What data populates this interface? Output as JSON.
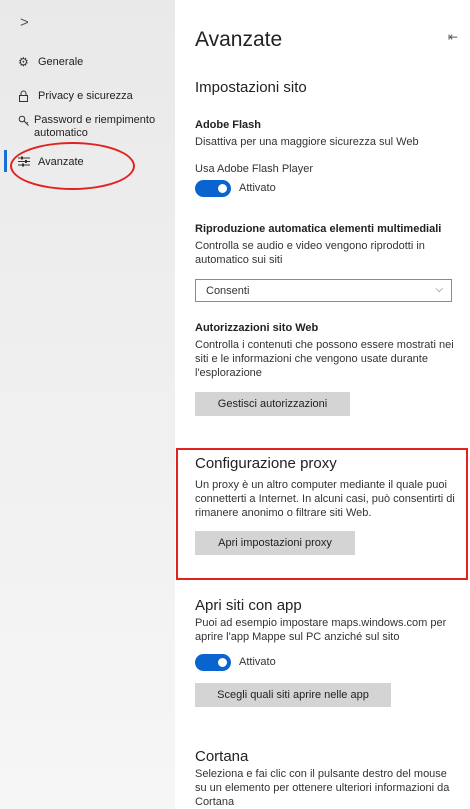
{
  "sidebar": {
    "collapse_glyph": ">",
    "items": [
      {
        "label": "Generale",
        "icon": "gear-icon"
      },
      {
        "label": "Privacy e sicurezza",
        "icon": "lock-icon"
      },
      {
        "label": "Password e riempimento automatico",
        "icon": "key-icon"
      },
      {
        "label": "Avanzate",
        "icon": "sliders-icon"
      }
    ]
  },
  "main": {
    "title": "Avanzate",
    "pin_glyph": "⇤",
    "site_settings": {
      "heading": "Impostazioni sito",
      "flash": {
        "heading": "Adobe Flash",
        "description": "Disattiva per una maggiore sicurezza sul Web",
        "toggle_label": "Usa Adobe Flash Player",
        "toggle_state": "Attivato"
      },
      "autoplay": {
        "heading": "Riproduzione automatica elementi multimediali",
        "description": "Controlla se audio e video vengono riprodotti in automatico sui siti",
        "selected": "Consenti"
      },
      "permissions": {
        "heading": "Autorizzazioni sito Web",
        "description": "Controlla i contenuti che possono essere mostrati nei siti e le informazioni che vengono usate durante l'esplorazione",
        "button": "Gestisci autorizzazioni"
      }
    },
    "proxy": {
      "heading": "Configurazione proxy",
      "description": "Un proxy è un altro computer mediante il quale puoi connetterti a Internet. In alcuni casi, può consentirti di rimanere anonimo o filtrare siti Web.",
      "button": "Apri impostazioni proxy"
    },
    "apps": {
      "heading": "Apri siti con app",
      "description": "Puoi ad esempio impostare maps.windows.com per aprire l'app Mappe sul PC anziché sul sito",
      "toggle_state": "Attivato",
      "button": "Scegli quali siti aprire nelle app"
    },
    "cortana": {
      "heading": "Cortana",
      "description": "Seleziona e fai clic con il pulsante destro del mouse su un elemento per ottenere ulteriori informazioni da Cortana"
    }
  },
  "colors": {
    "accent": "#0a64d0",
    "highlight": "#e2221f"
  }
}
